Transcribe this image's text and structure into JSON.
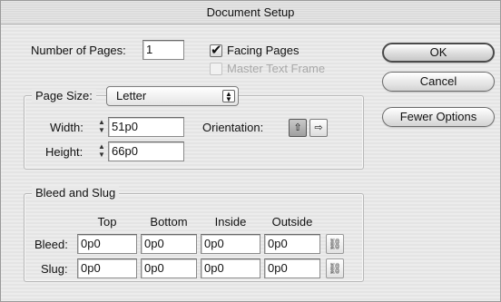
{
  "window": {
    "title": "Document Setup"
  },
  "pages": {
    "number_label": "Number of Pages:",
    "number_value": "1",
    "facing_pages_label": "Facing Pages",
    "facing_pages_checked": true,
    "master_text_frame_label": "Master Text Frame",
    "master_text_frame_enabled": false
  },
  "buttons": {
    "ok": "OK",
    "cancel": "Cancel",
    "fewer_options": "Fewer Options"
  },
  "page_size": {
    "label": "Page Size:",
    "selected": "Letter",
    "width_label": "Width:",
    "width_value": "51p0",
    "height_label": "Height:",
    "height_value": "66p0",
    "orientation_label": "Orientation:",
    "orientation_selected": "portrait"
  },
  "bleed_slug": {
    "title": "Bleed and Slug",
    "columns": [
      "Top",
      "Bottom",
      "Inside",
      "Outside"
    ],
    "bleed_label": "Bleed:",
    "bleed_values": [
      "0p0",
      "0p0",
      "0p0",
      "0p0"
    ],
    "slug_label": "Slug:",
    "slug_values": [
      "0p0",
      "0p0",
      "0p0",
      "0p0"
    ]
  },
  "icons": {
    "spinner": "up-down-arrows-icon",
    "portrait": "portrait-orientation-icon",
    "landscape": "landscape-orientation-icon",
    "link": "chain-link-icon",
    "popup_arrows": "updown-chevron-icon"
  }
}
